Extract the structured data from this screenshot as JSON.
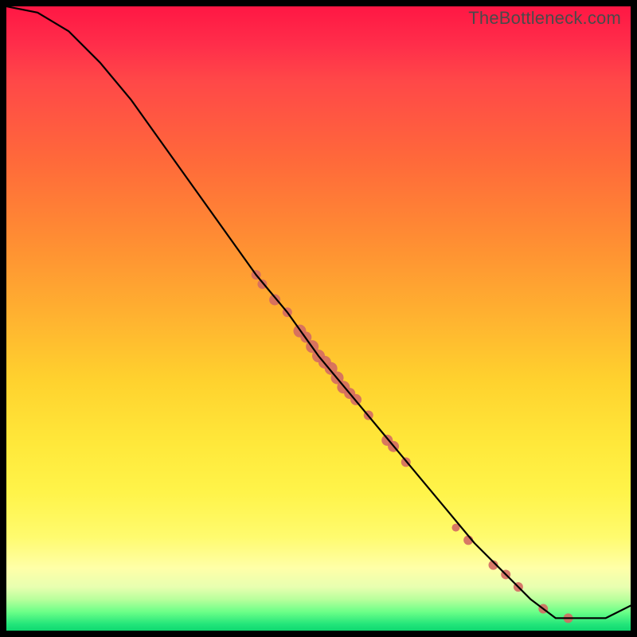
{
  "watermark": "TheBottleneck.com",
  "chart_data": {
    "type": "line",
    "title": "",
    "xlabel": "",
    "ylabel": "",
    "xlim": [
      0,
      100
    ],
    "ylim": [
      0,
      100
    ],
    "grid": false,
    "legend": false,
    "series": [
      {
        "name": "curve",
        "x": [
          0,
          5,
          10,
          15,
          20,
          25,
          30,
          35,
          40,
          45,
          50,
          55,
          60,
          65,
          70,
          75,
          80,
          84,
          88,
          92,
          96,
          100
        ],
        "y": [
          100,
          99,
          96,
          91,
          85,
          78,
          71,
          64,
          57,
          51,
          44,
          38,
          32,
          26,
          20,
          14,
          9,
          5,
          2,
          2,
          2,
          4
        ]
      }
    ],
    "points": {
      "name": "markers",
      "color": "#d46a63",
      "data": [
        {
          "x": 40,
          "y": 57,
          "r": 6
        },
        {
          "x": 41,
          "y": 55.5,
          "r": 6
        },
        {
          "x": 43,
          "y": 53,
          "r": 7
        },
        {
          "x": 45,
          "y": 51,
          "r": 6
        },
        {
          "x": 47,
          "y": 48,
          "r": 8
        },
        {
          "x": 48,
          "y": 47,
          "r": 7
        },
        {
          "x": 49,
          "y": 45.5,
          "r": 8
        },
        {
          "x": 50,
          "y": 44,
          "r": 8
        },
        {
          "x": 51,
          "y": 43,
          "r": 8
        },
        {
          "x": 52,
          "y": 42,
          "r": 8
        },
        {
          "x": 53,
          "y": 40.5,
          "r": 8
        },
        {
          "x": 54,
          "y": 39,
          "r": 8
        },
        {
          "x": 55,
          "y": 38,
          "r": 7
        },
        {
          "x": 56,
          "y": 37,
          "r": 7
        },
        {
          "x": 58,
          "y": 34.5,
          "r": 6
        },
        {
          "x": 61,
          "y": 30.5,
          "r": 7
        },
        {
          "x": 62,
          "y": 29.5,
          "r": 7
        },
        {
          "x": 64,
          "y": 27,
          "r": 6
        },
        {
          "x": 72,
          "y": 16.5,
          "r": 5
        },
        {
          "x": 74,
          "y": 14.5,
          "r": 6
        },
        {
          "x": 78,
          "y": 10.5,
          "r": 6
        },
        {
          "x": 80,
          "y": 9,
          "r": 6
        },
        {
          "x": 82,
          "y": 7,
          "r": 6
        },
        {
          "x": 86,
          "y": 3.5,
          "r": 6
        },
        {
          "x": 90,
          "y": 2,
          "r": 6
        }
      ]
    }
  }
}
